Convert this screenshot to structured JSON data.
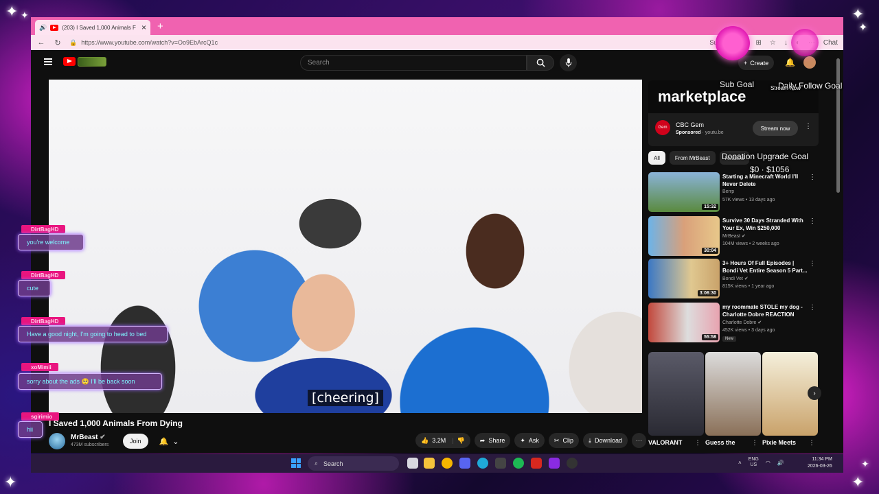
{
  "browser": {
    "tab_title": "(203) I Saved 1,000 Animals F",
    "url": "https://www.youtube.com/watch?v=Oo9EbArcQ1c",
    "summarize_label": "Summarize",
    "chat_label": "Chat"
  },
  "yt_header": {
    "search_placeholder": "Search",
    "create_label": "Create"
  },
  "video": {
    "caption": "[cheering]",
    "title": "I Saved 1,000 Animals From Dying",
    "channel": "MrBeast",
    "subscribers": "473M subscribers",
    "join_label": "Join",
    "likes": "3.2M",
    "share_label": "Share",
    "ask_label": "Ask",
    "clip_label": "Clip",
    "download_label": "Download"
  },
  "ad": {
    "banner": "marketplace",
    "logo_text": "Gem",
    "advertiser": "CBC Gem",
    "sponsored": "Sponsored",
    "domain": "youtu.be",
    "cta": "Stream now"
  },
  "chips": [
    "All",
    "From MrBeast",
    "Related"
  ],
  "recommendations": [
    {
      "title": "Starting a Minecraft World I'll Never Delete",
      "channel": "Berrp",
      "meta": "57K views • 13 days ago",
      "duration": "15:32",
      "thumb": "#5a8a3e",
      "new": ""
    },
    {
      "title": "Survive 30 Days Stranded With Your Ex, Win $250,000",
      "channel": "MrBeast",
      "meta": "104M views • 2 weeks ago",
      "duration": "30:04",
      "thumb": "#d9a07a",
      "new": ""
    },
    {
      "title": "3+ Hours Of Full Episodes | Bondi Vet Entire Season 5 Part...",
      "channel": "Bondi Vet",
      "meta": "815K views • 1 year ago",
      "duration": "3:06:30",
      "thumb": "#3c78c4",
      "new": ""
    },
    {
      "title": "my roommate STOLE my dog - Charlotte Dobre REACTION",
      "channel": "Charlotte Dobre",
      "meta": "452K views • 3 days ago",
      "duration": "55:58",
      "thumb": "#c2493d",
      "new": "New"
    }
  ],
  "shorts": [
    {
      "title": "VALORANT",
      "color": "#3a3a45"
    },
    {
      "title": "Guess the",
      "color": "#8a7058"
    },
    {
      "title": "Pixie Meets",
      "color": "#e8e0c8"
    }
  ],
  "overlay": {
    "sub_goal": "Sub Goal",
    "daily_follow_goal": "Daily Follow Goal",
    "stream_now": "Stream Now",
    "donation_goal": "Donation Upgrade Goal",
    "donation_amount": "$0 · $1056",
    "chat": [
      {
        "user": "DirtBagHD",
        "msg": "you're welcome"
      },
      {
        "user": "DirtBagHD",
        "msg": "cute"
      },
      {
        "user": "DirtBagHD",
        "msg": "Have a good night, I'm going to head to bed"
      },
      {
        "user": "xoMimii",
        "msg": "sorry about the ads 🥺 I'll be back soon"
      },
      {
        "user": "sgirimio",
        "msg": "hii"
      }
    ]
  },
  "taskbar": {
    "search_label": "Search",
    "lang_top": "ENG",
    "lang_bottom": "US",
    "time": "11:34 PM",
    "date": "2026-03-26"
  },
  "colors": {
    "accent": "#f062b0",
    "youtube_red": "#ff0000",
    "chat_name_bg": "#e9157f"
  }
}
